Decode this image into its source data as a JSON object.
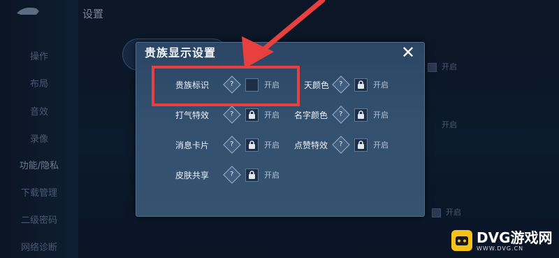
{
  "header": {
    "title": "设置"
  },
  "sidebar": {
    "items": [
      {
        "label": "操作"
      },
      {
        "label": "布局"
      },
      {
        "label": "音效"
      },
      {
        "label": "录像"
      },
      {
        "label": "功能/隐私"
      },
      {
        "label": "下载管理"
      },
      {
        "label": "二级密码"
      },
      {
        "label": "网络诊断"
      }
    ]
  },
  "background": {
    "toggle_right_1": "开启",
    "toggle_right_2": "开启",
    "toggle_right_3": "开启"
  },
  "dialog": {
    "title": "贵族显示设置",
    "close_icon": "close-icon",
    "options": [
      {
        "label": "贵族标识",
        "state": "开启",
        "control": "checkbox"
      },
      {
        "label": "天颜色",
        "state": "开启",
        "control": "lock"
      },
      {
        "label": "打气特效",
        "state": "开启",
        "control": "lock"
      },
      {
        "label": "名字颜色",
        "state": "开启",
        "control": "lock"
      },
      {
        "label": "消息卡片",
        "state": "开启",
        "control": "lock"
      },
      {
        "label": "点赞特效",
        "state": "开启",
        "control": "lock"
      },
      {
        "label": "皮肤共享",
        "state": "开启",
        "control": "lock"
      }
    ],
    "help_glyph": "?"
  },
  "annotation": {
    "color": "#e8403e"
  },
  "watermark": {
    "main": "DVG游戏网",
    "sub": "WWW.DVG.CN"
  }
}
